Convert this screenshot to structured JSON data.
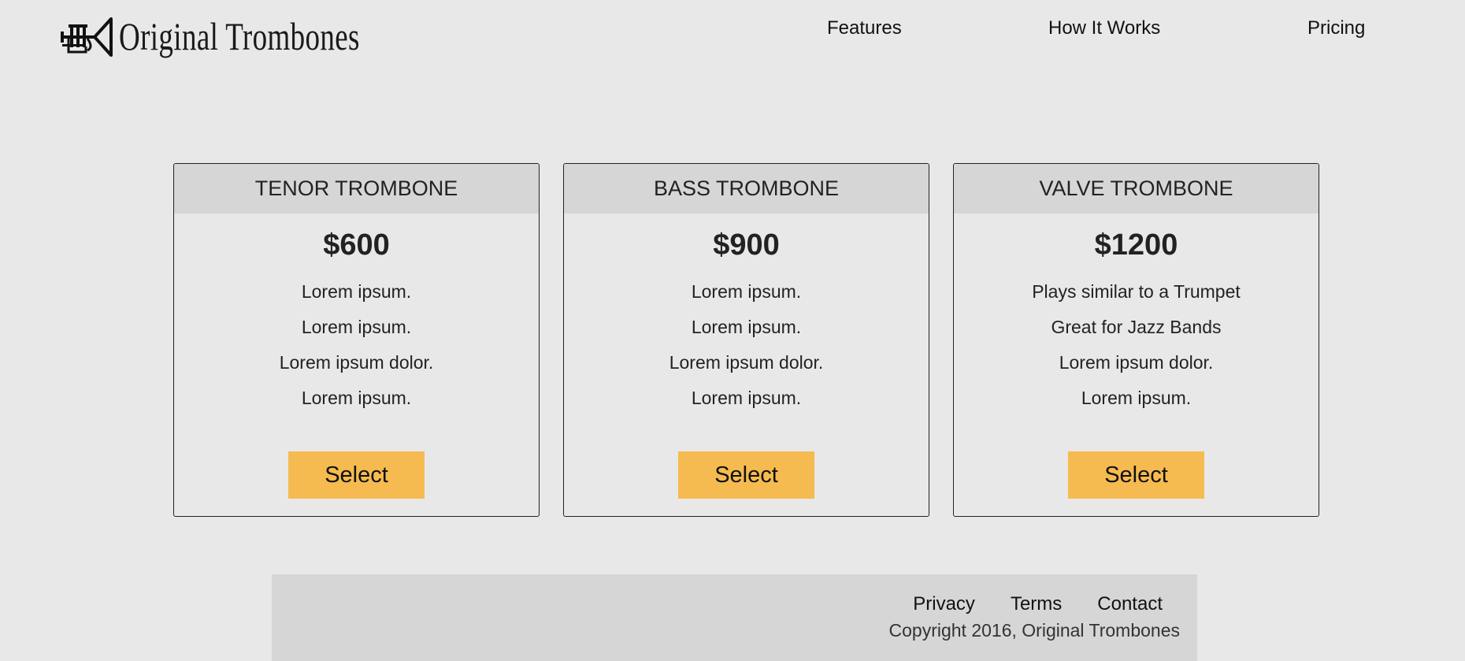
{
  "brand": {
    "name": "Original Trombones",
    "icon": "trumpet-icon"
  },
  "nav": {
    "features": "Features",
    "how_it_works": "How It Works",
    "pricing": "Pricing"
  },
  "plans": [
    {
      "title": "TENOR TROMBONE",
      "price": "$600",
      "features": [
        "Lorem ipsum.",
        "Lorem ipsum.",
        "Lorem ipsum dolor.",
        "Lorem ipsum."
      ],
      "button": "Select"
    },
    {
      "title": "BASS TROMBONE",
      "price": "$900",
      "features": [
        "Lorem ipsum.",
        "Lorem ipsum.",
        "Lorem ipsum dolor.",
        "Lorem ipsum."
      ],
      "button": "Select"
    },
    {
      "title": "VALVE TROMBONE",
      "price": "$1200",
      "features": [
        "Plays similar to a Trumpet",
        "Great for Jazz Bands",
        "Lorem ipsum dolor.",
        "Lorem ipsum."
      ],
      "button": "Select"
    }
  ],
  "footer": {
    "links": [
      "Privacy",
      "Terms",
      "Contact"
    ],
    "copyright": "Copyright 2016, Original Trombones"
  },
  "colors": {
    "background": "#e8e8e8",
    "panel": "#d6d6d6",
    "button": "#f6bb50",
    "text": "#222222"
  }
}
